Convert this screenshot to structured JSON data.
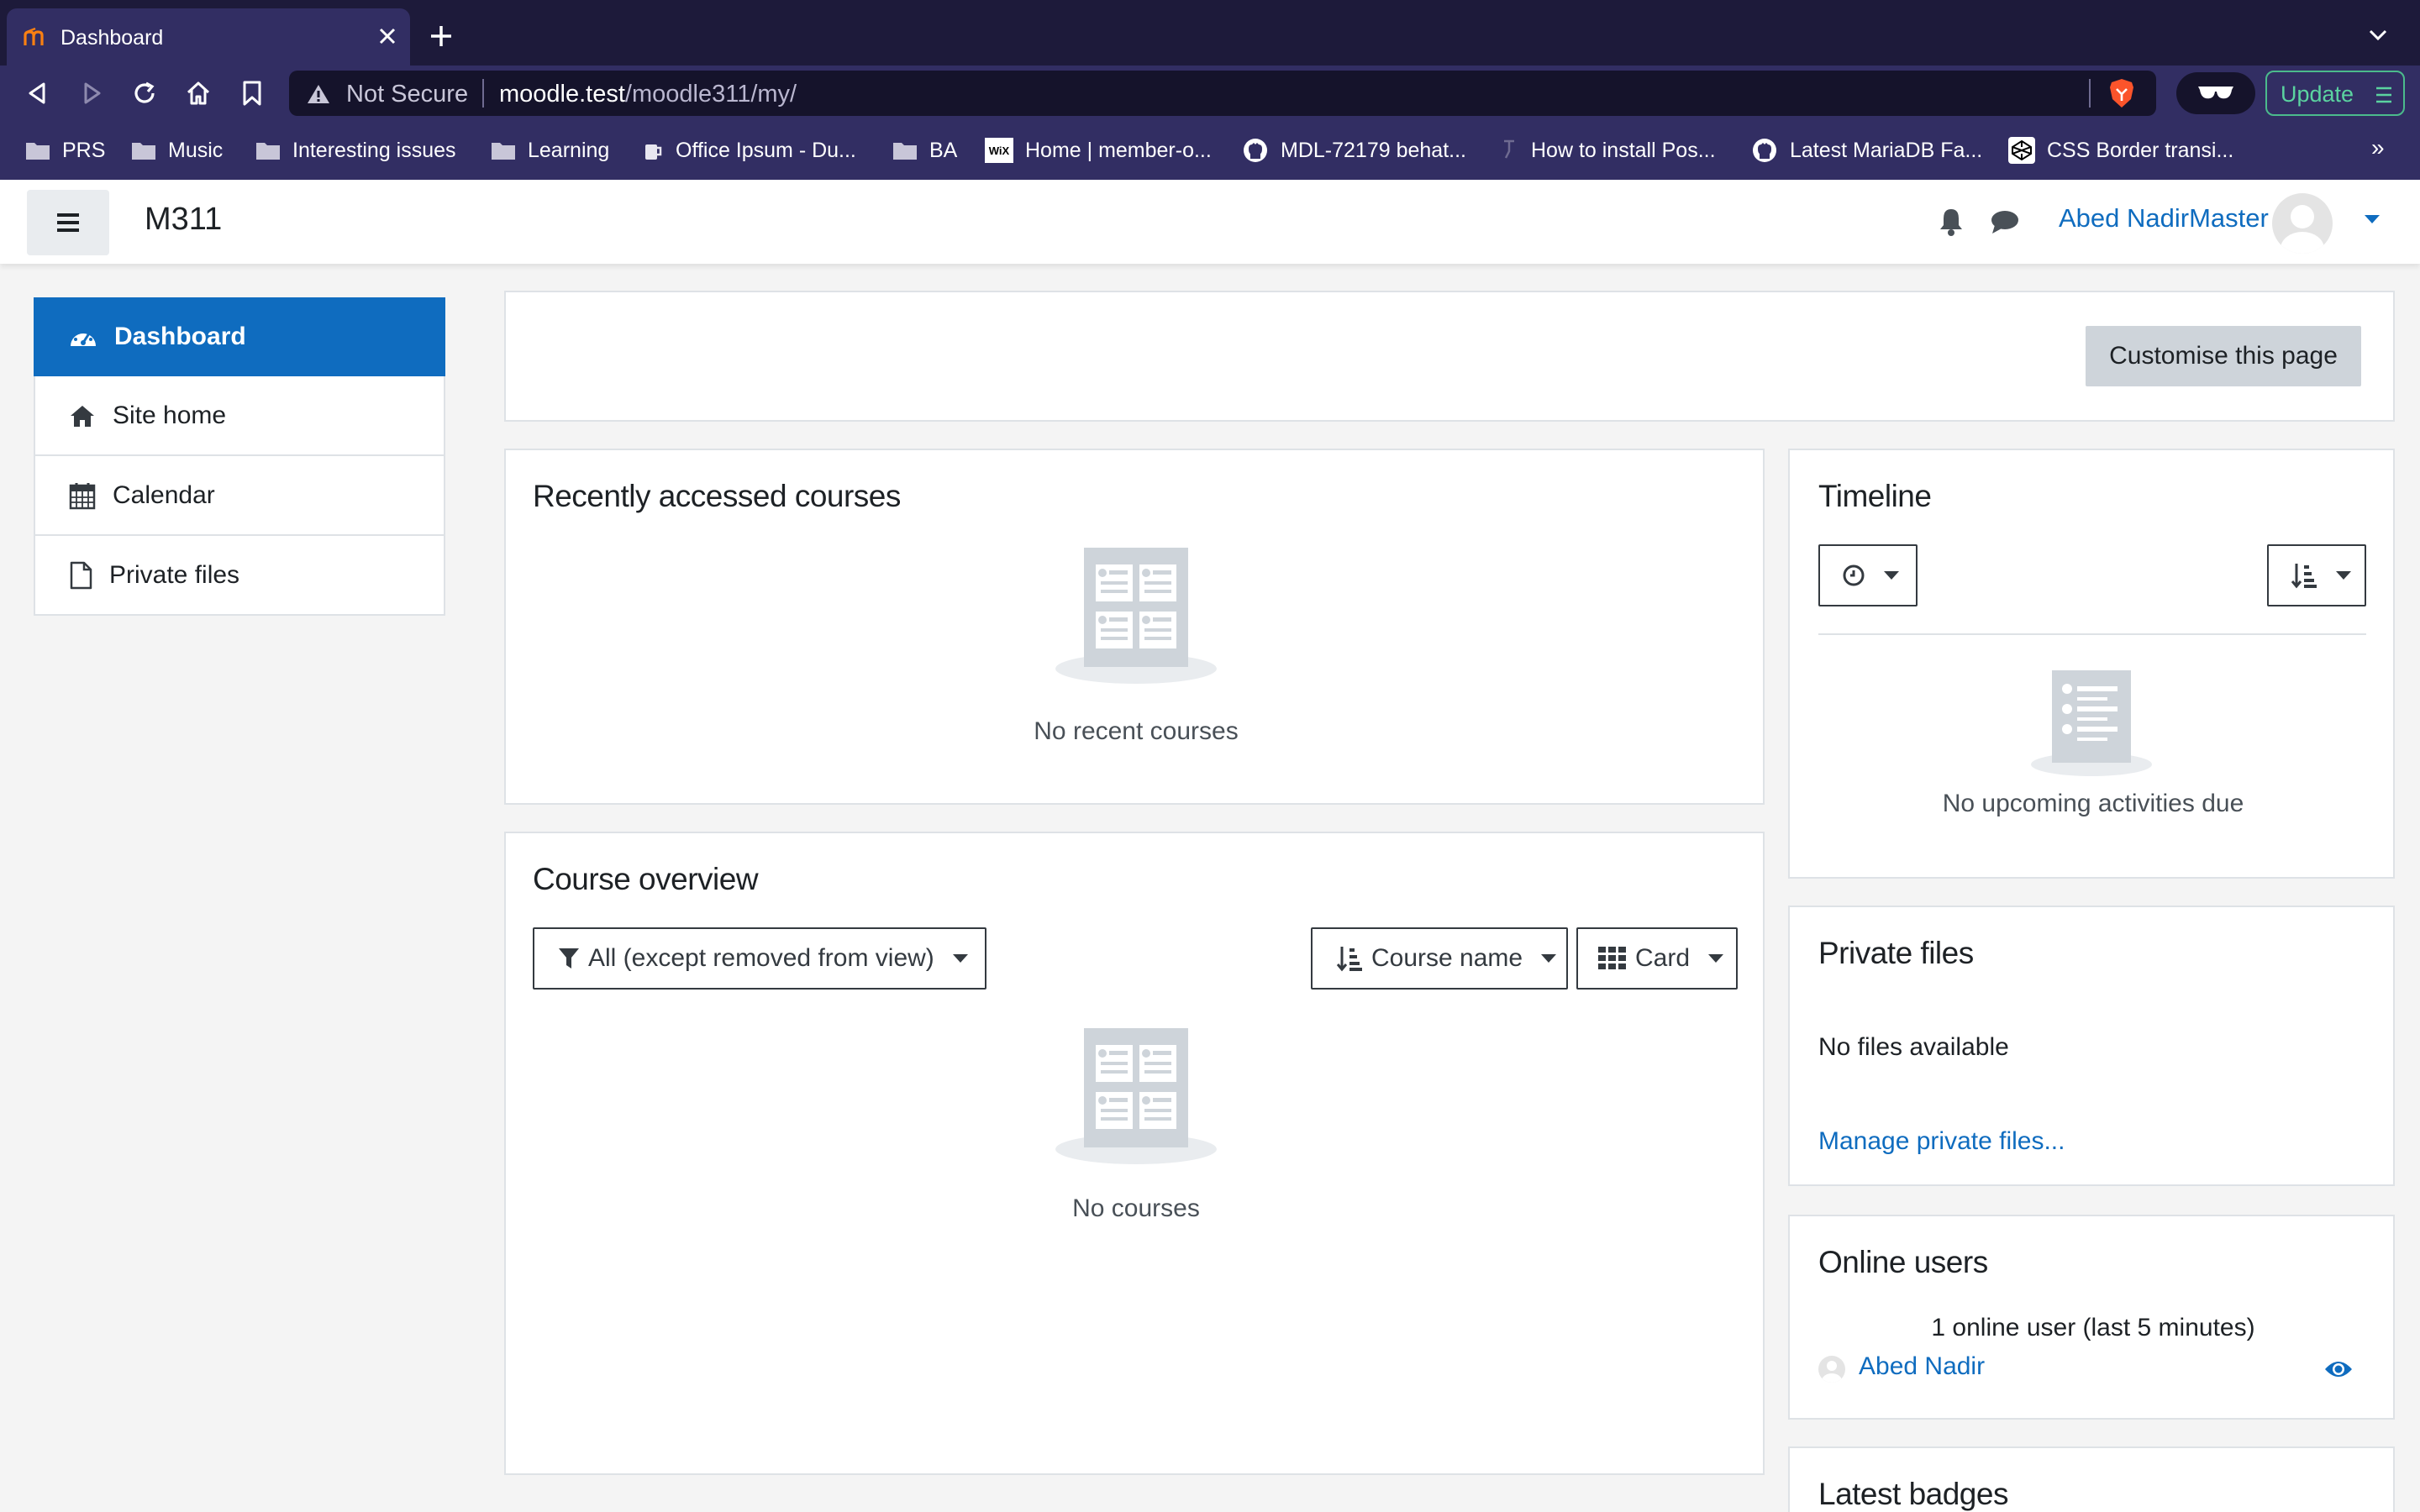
{
  "browser": {
    "tab_title": "Dashboard",
    "url_not_secure": "Not Secure",
    "url_host": "moodle.test",
    "url_path": "/moodle311/my/",
    "update_label": "Update",
    "bookmarks": [
      {
        "label": "PRS",
        "icon": "folder-icon"
      },
      {
        "label": "Music",
        "icon": "folder-icon"
      },
      {
        "label": "Interesting issues",
        "icon": "folder-icon"
      },
      {
        "label": "Learning",
        "icon": "folder-icon"
      },
      {
        "label": "Office Ipsum - Du...",
        "icon": "coffee-icon"
      },
      {
        "label": "BA",
        "icon": "folder-icon"
      },
      {
        "label": "Home | member-o...",
        "icon": "wix-icon"
      },
      {
        "label": "MDL-72179 behat...",
        "icon": "github-icon"
      },
      {
        "label": "How to install Pos...",
        "icon": "dot-icon"
      },
      {
        "label": "Latest MariaDB Fa...",
        "icon": "github-icon"
      },
      {
        "label": "CSS Border transi...",
        "icon": "codepen-icon"
      }
    ],
    "bookmarks_more": "»"
  },
  "navbar": {
    "site_name": "M311",
    "user_name": "Abed NadirMaster"
  },
  "leftnav": {
    "items": [
      {
        "label": "Dashboard",
        "icon": "dashboard-icon",
        "active": true
      },
      {
        "label": "Site home",
        "icon": "home-icon"
      },
      {
        "label": "Calendar",
        "icon": "calendar-icon"
      },
      {
        "label": "Private files",
        "icon": "file-icon"
      }
    ]
  },
  "page": {
    "customise_button": "Customise this page"
  },
  "recent_courses": {
    "title": "Recently accessed courses",
    "empty_text": "No recent courses"
  },
  "course_overview": {
    "title": "Course overview",
    "filter_label": "All (except removed from view)",
    "sort_label": "Course name",
    "view_label": "Card",
    "empty_text": "No courses"
  },
  "timeline": {
    "title": "Timeline",
    "empty_text": "No upcoming activities due"
  },
  "private_files": {
    "title": "Private files",
    "empty_text": "No files available",
    "manage_link": "Manage private files..."
  },
  "online_users": {
    "title": "Online users",
    "summary": "1 online user (last 5 minutes)",
    "users": [
      "Abed Nadir"
    ]
  },
  "latest_badges": {
    "title": "Latest badges"
  },
  "colors": {
    "brand": "#0f6cbf",
    "browser_bg": "#322e63",
    "update_accent": "#4bbb8c"
  }
}
